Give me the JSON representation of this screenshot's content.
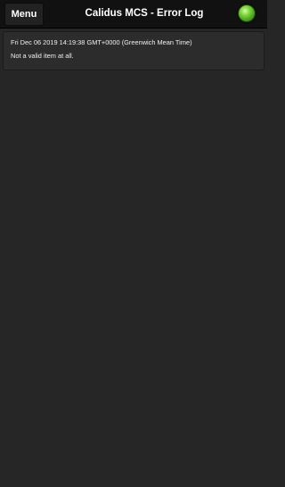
{
  "header": {
    "menu_label": "Menu",
    "title": "Calidus MCS - Error Log",
    "status_color": "#6ac22a"
  },
  "log": {
    "entries": [
      {
        "timestamp": "Fri Dec 06 2019 14:19:38 GMT+0000 (Greenwich Mean Time)",
        "message": "Not a valid item at all."
      }
    ]
  },
  "colors": {
    "background": "#262626",
    "header_background": "#111111",
    "entry_background": "#2c2c2c",
    "text": "#ffffff"
  }
}
